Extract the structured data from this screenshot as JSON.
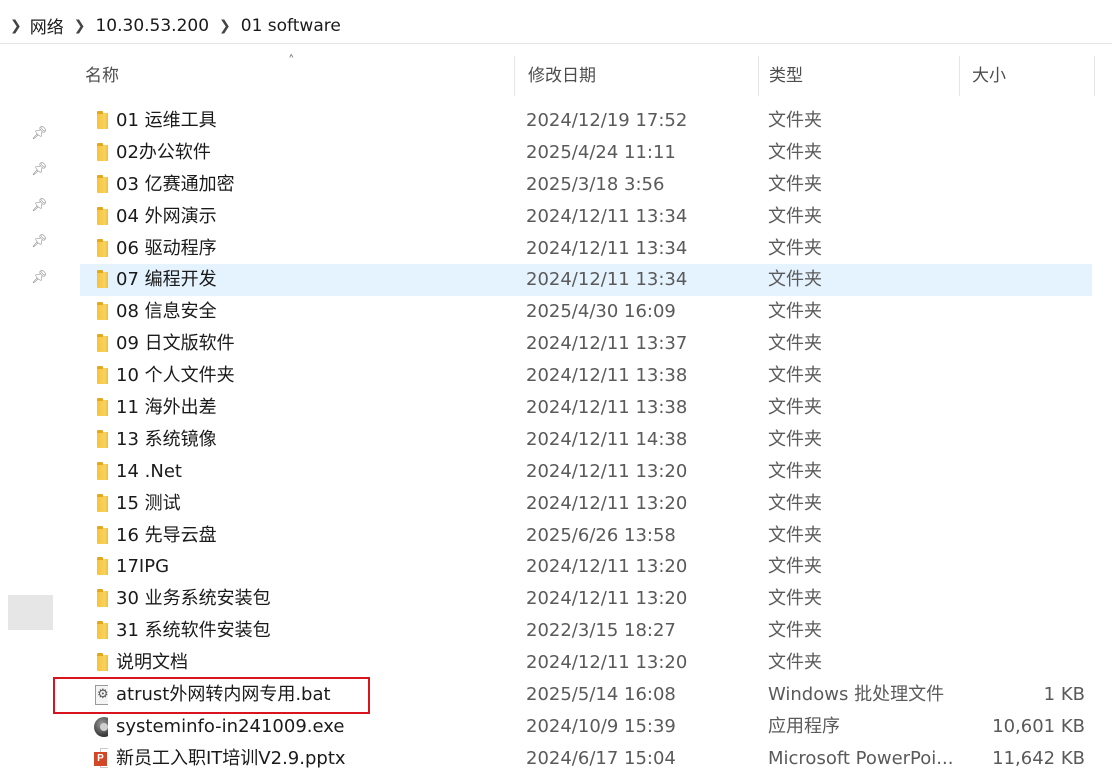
{
  "breadcrumb": {
    "items": [
      "网络",
      "10.30.53.200",
      "01 software"
    ]
  },
  "columns": {
    "name": "名称",
    "date": "修改日期",
    "type": "类型",
    "size": "大小"
  },
  "files": [
    {
      "name": "01 运维工具",
      "date": "2024/12/19 17:52",
      "type": "文件夹",
      "size": "",
      "icon": "folder-icon"
    },
    {
      "name": "02办公软件",
      "date": "2025/4/24 11:11",
      "type": "文件夹",
      "size": "",
      "icon": "folder-icon"
    },
    {
      "name": "03 亿赛通加密",
      "date": "2025/3/18 3:56",
      "type": "文件夹",
      "size": "",
      "icon": "folder-icon"
    },
    {
      "name": "04 外网演示",
      "date": "2024/12/11 13:34",
      "type": "文件夹",
      "size": "",
      "icon": "folder-icon"
    },
    {
      "name": "06 驱动程序",
      "date": "2024/12/11 13:34",
      "type": "文件夹",
      "size": "",
      "icon": "folder-icon"
    },
    {
      "name": "07 编程开发",
      "date": "2024/12/11 13:34",
      "type": "文件夹",
      "size": "",
      "icon": "folder-icon"
    },
    {
      "name": "08 信息安全",
      "date": "2025/4/30 16:09",
      "type": "文件夹",
      "size": "",
      "icon": "folder-icon"
    },
    {
      "name": "09 日文版软件",
      "date": "2024/12/11 13:37",
      "type": "文件夹",
      "size": "",
      "icon": "folder-icon"
    },
    {
      "name": "10 个人文件夹",
      "date": "2024/12/11 13:38",
      "type": "文件夹",
      "size": "",
      "icon": "folder-icon"
    },
    {
      "name": "11 海外出差",
      "date": "2024/12/11 13:38",
      "type": "文件夹",
      "size": "",
      "icon": "folder-icon"
    },
    {
      "name": "13 系统镜像",
      "date": "2024/12/11 14:38",
      "type": "文件夹",
      "size": "",
      "icon": "folder-icon"
    },
    {
      "name": "14 .Net",
      "date": "2024/12/11 13:20",
      "type": "文件夹",
      "size": "",
      "icon": "folder-icon"
    },
    {
      "name": "15 测试",
      "date": "2024/12/11 13:20",
      "type": "文件夹",
      "size": "",
      "icon": "folder-icon"
    },
    {
      "name": "16 先导云盘",
      "date": "2025/6/26 13:58",
      "type": "文件夹",
      "size": "",
      "icon": "folder-icon"
    },
    {
      "name": "17IPG",
      "date": "2024/12/11 13:20",
      "type": "文件夹",
      "size": "",
      "icon": "folder-icon"
    },
    {
      "name": "30 业务系统安装包",
      "date": "2024/12/11 13:20",
      "type": "文件夹",
      "size": "",
      "icon": "folder-icon"
    },
    {
      "name": "31 系统软件安装包",
      "date": "2022/3/15 18:27",
      "type": "文件夹",
      "size": "",
      "icon": "folder-icon"
    },
    {
      "name": "说明文档",
      "date": "2024/12/11 13:20",
      "type": "文件夹",
      "size": "",
      "icon": "folder-icon"
    },
    {
      "name": "atrust外网转内网专用.bat",
      "date": "2025/5/14 16:08",
      "type": "Windows 批处理文件",
      "size": "1 KB",
      "icon": "batch-file-icon"
    },
    {
      "name": "systeminfo-in241009.exe",
      "date": "2024/10/9 15:39",
      "type": "应用程序",
      "size": "10,601 KB",
      "icon": "exe-icon"
    },
    {
      "name": "新员工入职IT培训V2.9.pptx",
      "date": "2024/6/17 15:04",
      "type": "Microsoft PowerPoi...",
      "size": "11,642 KB",
      "icon": "powerpoint-icon"
    }
  ],
  "icons": {
    "breadcrumb_separator": "chevron-right-icon",
    "pin": "pin-icon",
    "sort": "sort-ascending-icon"
  },
  "colors": {
    "hover_row": "#e5f3ff",
    "highlight_box": "#d9141f",
    "folder": "#f6c33a"
  }
}
